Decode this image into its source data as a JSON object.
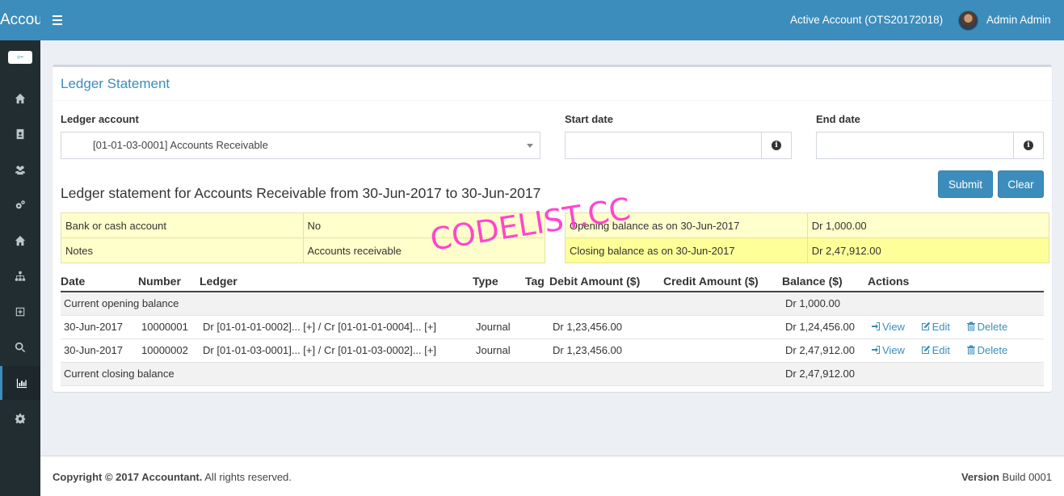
{
  "header": {
    "app_name": "Accountant",
    "active_account": "Active Account (OTS20172018)",
    "user_name": "Admin Admin"
  },
  "sidebar": {
    "items": [
      {
        "icon": "home-icon"
      },
      {
        "icon": "address-book-icon"
      },
      {
        "icon": "users-icon"
      },
      {
        "icon": "cogs-icon"
      },
      {
        "icon": "home-icon"
      },
      {
        "icon": "sitemap-icon"
      },
      {
        "icon": "plus-square-icon"
      },
      {
        "icon": "search-icon"
      },
      {
        "icon": "bar-chart-icon",
        "active": true
      },
      {
        "icon": "gear-icon"
      }
    ]
  },
  "box": {
    "title": "Ledger Statement"
  },
  "form": {
    "ledger_label": "Ledger account",
    "ledger_value": "[01-01-03-0001] Accounts Receivable",
    "start_label": "Start date",
    "start_value": "",
    "end_label": "End date",
    "end_value": "",
    "submit_label": "Submit",
    "clear_label": "Clear"
  },
  "statement": {
    "heading": "Ledger statement for Accounts Receivable from 30-Jun-2017 to 30-Jun-2017",
    "bank_label": "Bank or cash account",
    "bank_value": "No",
    "notes_label": "Notes",
    "notes_value": "Accounts receivable",
    "opening_label": "Opening balance as on 30-Jun-2017",
    "opening_value": "Dr 1,000.00",
    "closing_label": "Closing balance as on 30-Jun-2017",
    "closing_value": "Dr 2,47,912.00"
  },
  "table": {
    "headers": [
      "Date",
      "Number",
      "Ledger",
      "Type",
      "Tag",
      "Debit Amount ($)",
      "Credit Amount ($)",
      "Balance ($)",
      "Actions"
    ],
    "opening_row": {
      "label": "Current opening balance",
      "balance": "Dr 1,000.00"
    },
    "rows": [
      {
        "date": "30-Jun-2017",
        "number": "10000001",
        "ledger": "Dr [01-01-01-0002]... [+] / Cr [01-01-01-0004]... [+]",
        "type": "Journal",
        "tag": "",
        "debit": "Dr 1,23,456.00",
        "credit": "",
        "balance": "Dr 1,24,456.00"
      },
      {
        "date": "30-Jun-2017",
        "number": "10000002",
        "ledger": "Dr [01-01-03-0001]... [+] / Cr [01-01-03-0002]... [+]",
        "type": "Journal",
        "tag": "",
        "debit": "Dr 1,23,456.00",
        "credit": "",
        "balance": "Dr 2,47,912.00"
      }
    ],
    "closing_row": {
      "label": "Current closing balance",
      "balance": "Dr 2,47,912.00"
    },
    "actions": {
      "view": "View",
      "edit": "Edit",
      "delete": "Delete"
    }
  },
  "watermark": "CODELIST.CC",
  "footer": {
    "copyright_bold": "Copyright © 2017 Accountant.",
    "copyright_rest": " All rights reserved.",
    "version_bold": "Version",
    "version_rest": " Build 0001"
  },
  "colors": {
    "primary": "#3c8dbc",
    "sidebar": "#222d32",
    "info_bg": "#ffffcc",
    "info_highlight": "#ffff99",
    "watermark": "#ff33cc"
  }
}
